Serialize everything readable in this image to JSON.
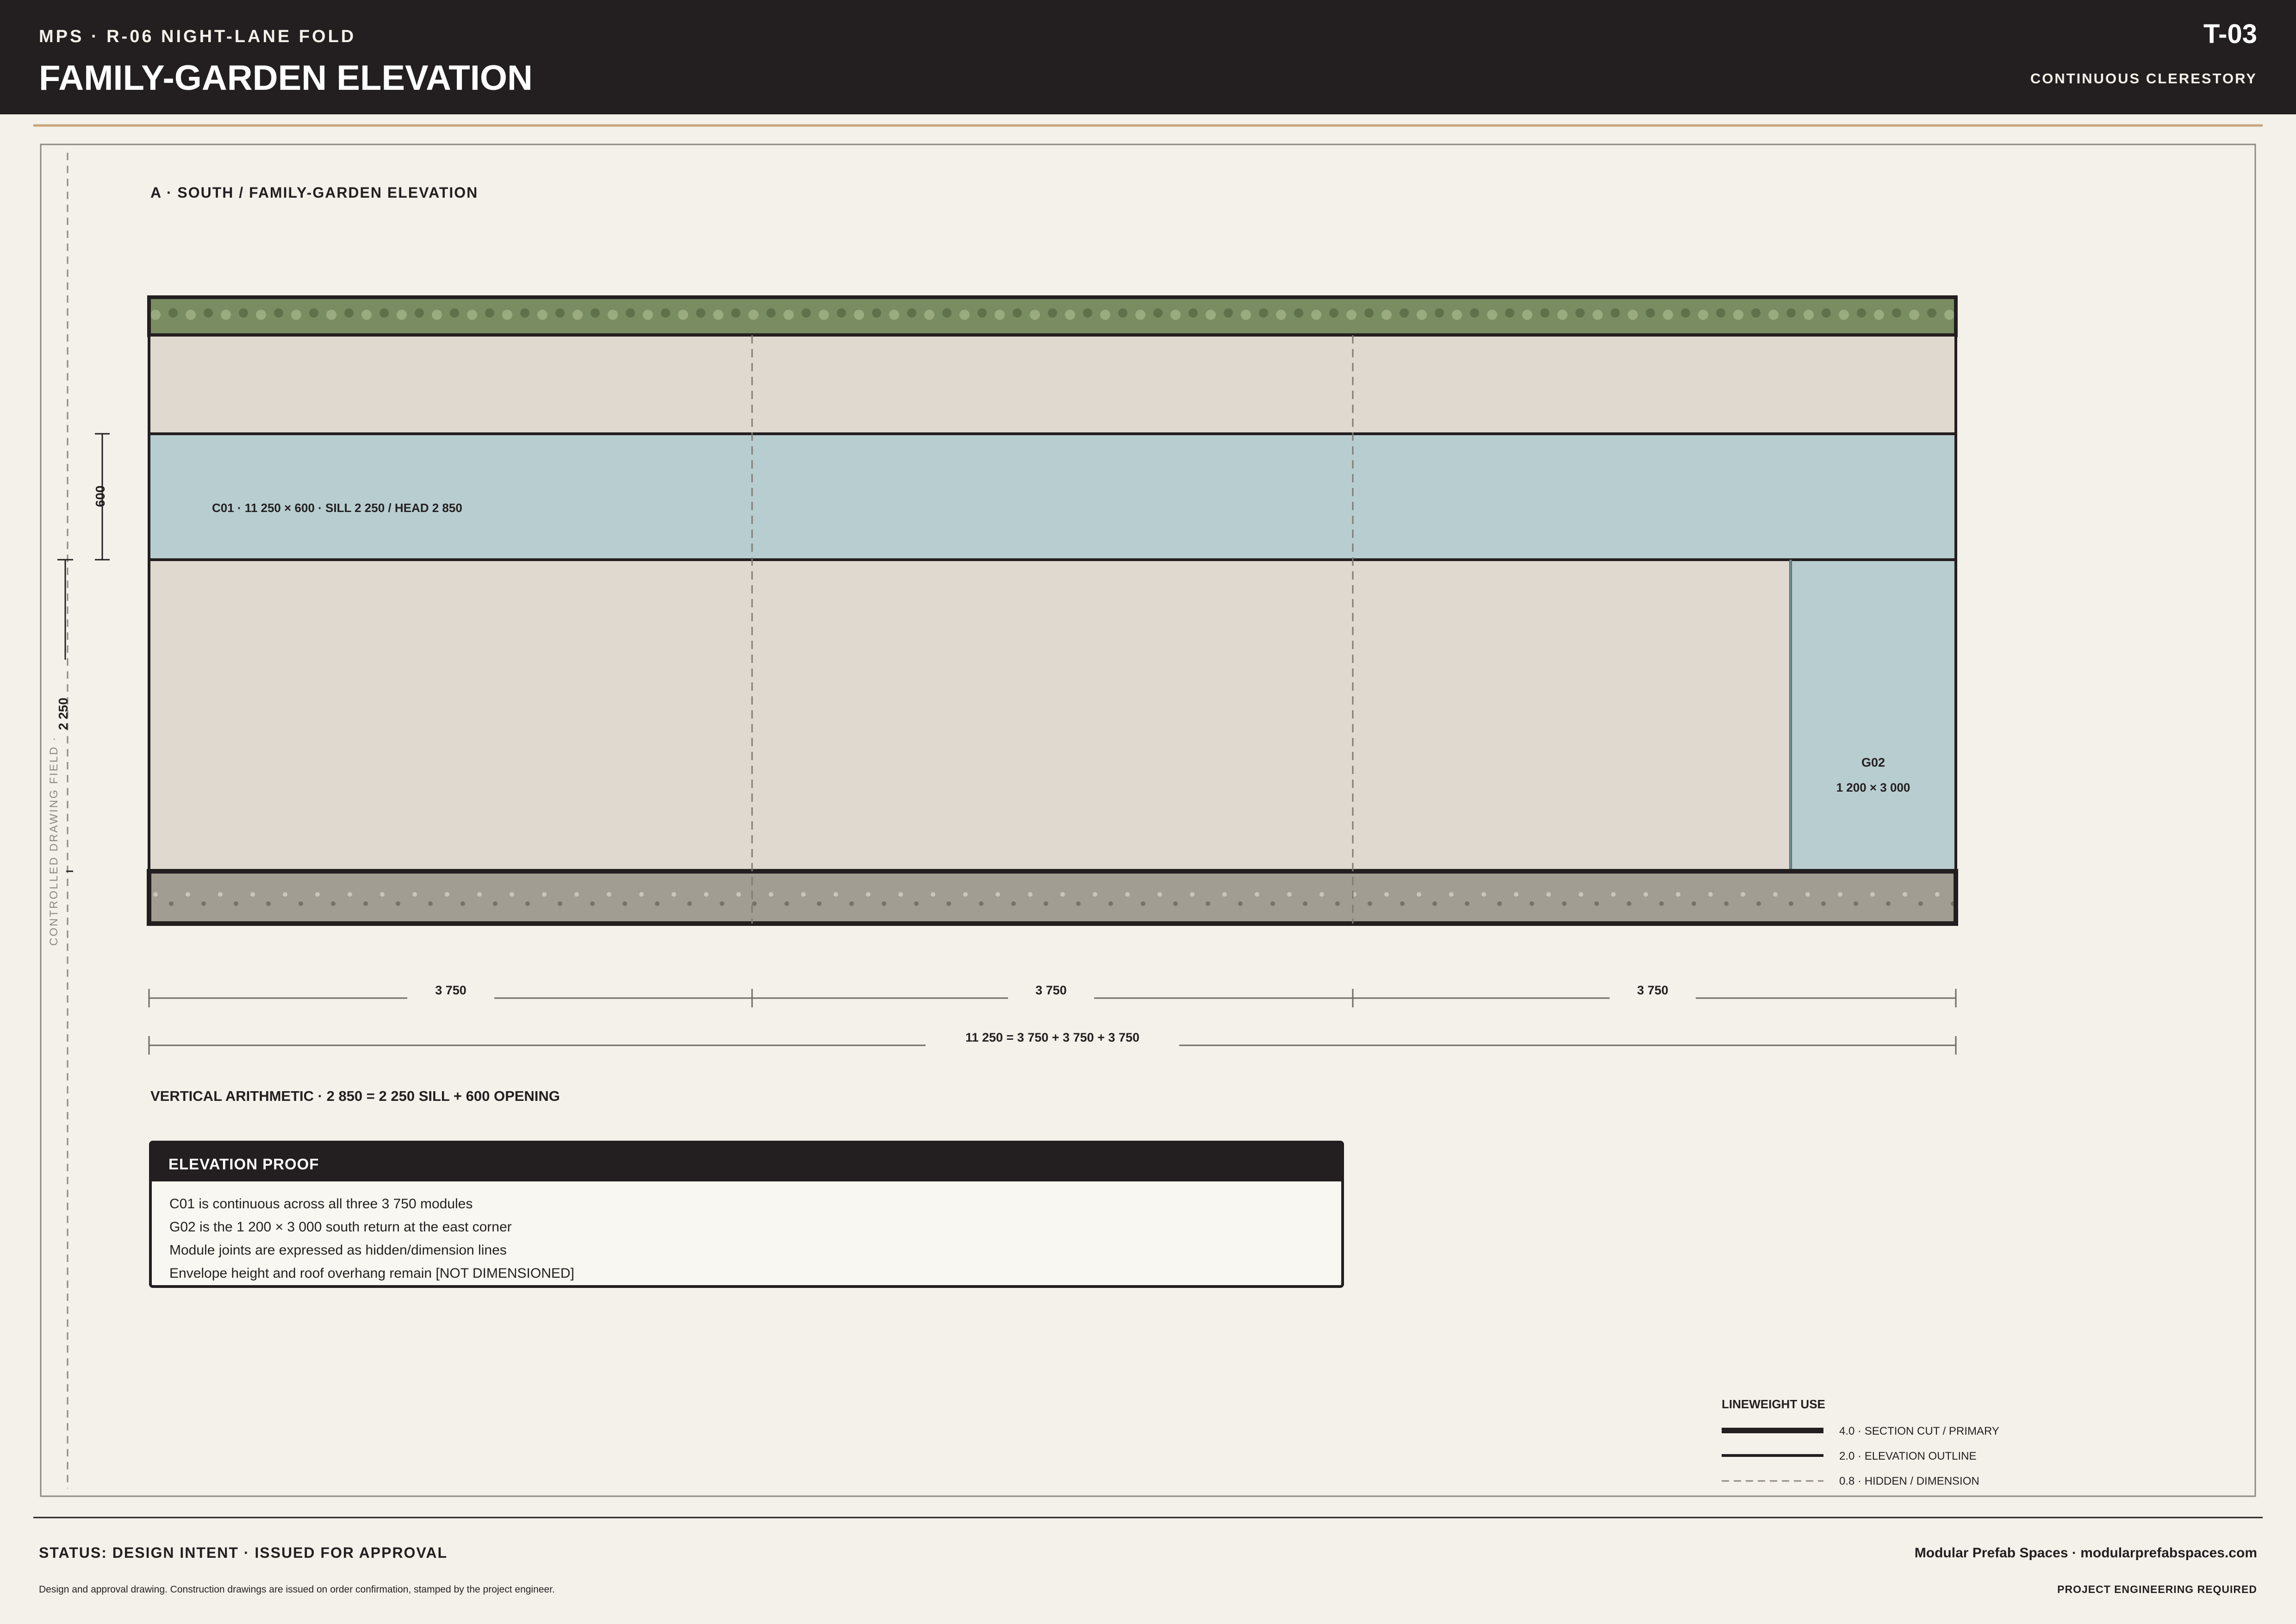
{
  "header": {
    "project": "MPS · R-06 NIGHT-LANE FOLD",
    "title": "FAMILY-GARDEN ELEVATION",
    "sheet_no": "T-03",
    "subtitle": "CONTINUOUS CLERESTORY"
  },
  "drawing": {
    "side_label": "CONTROLLED DRAWING FIELD ·",
    "section_title": "A · SOUTH / FAMILY-GARDEN ELEVATION",
    "clerestory_label": "C01 · 11 250 × 600 · SILL 2 250 / HEAD 2 850",
    "glazing_label_1": "G02",
    "glazing_label_2": "1 200 × 3 000",
    "dim_opening": "600",
    "dim_sill": "2 250",
    "module_dims": [
      "3 750",
      "3 750",
      "3 750"
    ],
    "total_dim": "11 250 = 3 750 + 3 750 + 3 750",
    "arithmetic": "VERTICAL ARITHMETIC · 2 850 = 2 250 SILL + 600 OPENING"
  },
  "proof": {
    "title": "ELEVATION PROOF",
    "lines": [
      "C01 is continuous across all three 3 750 modules",
      "G02 is the 1 200 × 3 000 south return at the east corner",
      "Module joints are expressed as hidden/dimension lines",
      "Envelope height and roof overhang remain [NOT DIMENSIONED]"
    ]
  },
  "legend": {
    "title": "LINEWEIGHT USE",
    "items": [
      "4.0 · SECTION CUT / PRIMARY",
      "2.0 · ELEVATION OUTLINE",
      "0.8 · HIDDEN / DIMENSION"
    ]
  },
  "footer": {
    "status": "STATUS: DESIGN INTENT · ISSUED FOR APPROVAL",
    "note": "Design and approval drawing. Construction drawings are issued on order confirmation, stamped by the project engineer.",
    "company": "Modular Prefab Spaces · modularprefabspaces.com",
    "engineering": "PROJECT ENGINEERING REQUIRED"
  },
  "colors": {
    "ink": "#231f20",
    "paper": "#f3f1ea",
    "accent_rule": "#c8a27a",
    "wall": "#e0d9cf",
    "glass": "#b8cdd0",
    "green_roof": "#7a8c62",
    "plinth": "#a19d92"
  }
}
